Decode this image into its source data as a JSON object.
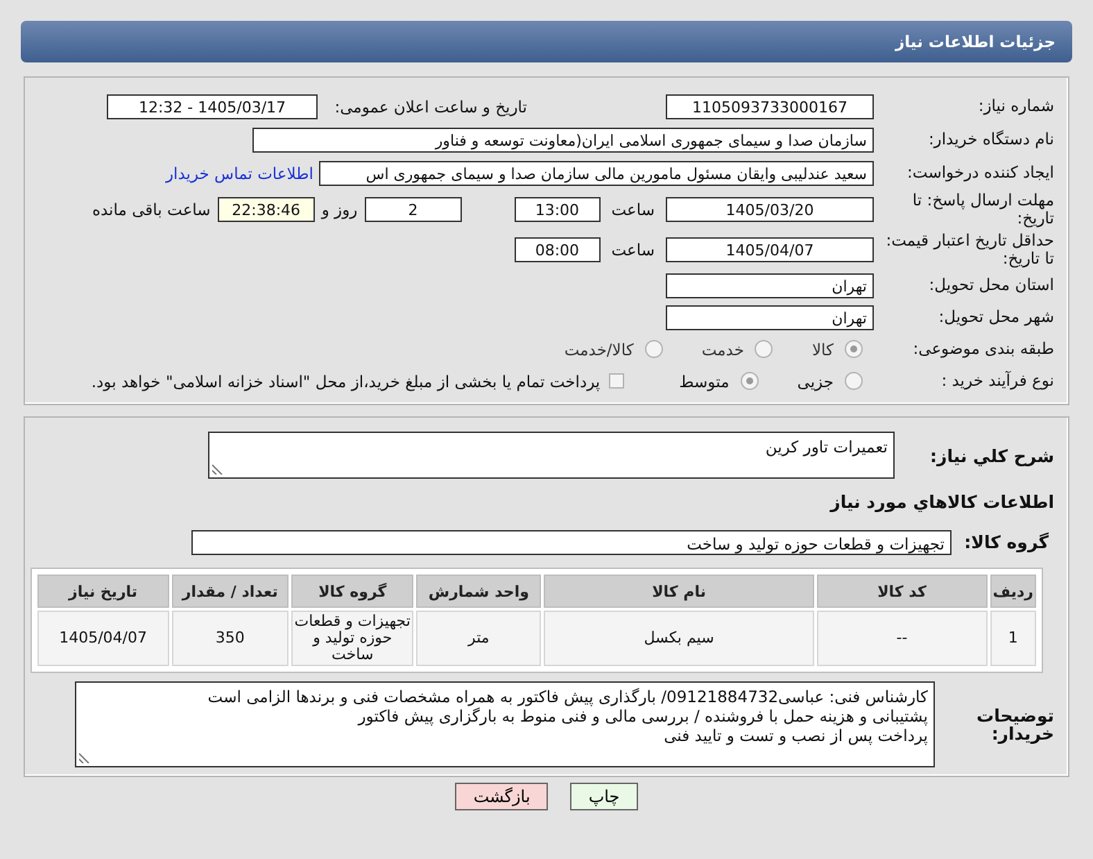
{
  "header": {
    "title": "جزئیات اطلاعات نیاز"
  },
  "need_number": {
    "label": "شماره نیاز:",
    "value": "1105093733000167"
  },
  "announce": {
    "label": "تاریخ و ساعت اعلان عمومی:",
    "value": "1405/03/17 - 12:32"
  },
  "buyer_org": {
    "label": "نام دستگاه خریدار:",
    "value": "سازمان صدا و سیمای جمهوری اسلامی ایران(معاونت توسعه و فناور"
  },
  "requester": {
    "label": "ایجاد کننده درخواست:",
    "value": "سعید عندلیبی وایقان مسئول مامورین مالی  سازمان صدا و سیمای جمهوری اس",
    "link": "اطلاعات تماس خریدار"
  },
  "reply_deadline": {
    "label": "مهلت ارسال پاسخ: تا تاریخ:",
    "date": "1405/03/20",
    "time_label": "ساعت",
    "time": "13:00",
    "days": "2",
    "days_label": "روز و",
    "remaining": "22:38:46",
    "remaining_label": "ساعت باقی مانده"
  },
  "price_validity": {
    "label": "حداقل تاریخ اعتبار قیمت: تا تاریخ:",
    "date": "1405/04/07",
    "time_label": "ساعت",
    "time": "08:00"
  },
  "province": {
    "label": "استان محل تحویل:",
    "value": "تهران"
  },
  "city": {
    "label": "شهر محل تحویل:",
    "value": "تهران"
  },
  "classification": {
    "label": "طبقه بندی موضوعی:",
    "options": [
      {
        "label": "کالا",
        "selected": true
      },
      {
        "label": "خدمت",
        "selected": false
      },
      {
        "label": "کالا/خدمت",
        "selected": false
      }
    ]
  },
  "process": {
    "label": "نوع فرآیند خرید :",
    "options": [
      {
        "label": "جزیی",
        "selected": false
      },
      {
        "label": "متوسط",
        "selected": true
      }
    ],
    "treasury": {
      "label": "پرداخت تمام یا بخشی از مبلغ خرید،از محل \"اسناد خزانه اسلامی\" خواهد بود.",
      "checked": false
    }
  },
  "description": {
    "label": "شرح کلي نیاز:",
    "value": "تعمیرات تاور کرین"
  },
  "goods_heading": "اطلاعات کالاهاي مورد نیاز",
  "goods_group": {
    "label": "گروه کالا:",
    "value": "تجهیزات و قطعات حوزه تولید و ساخت"
  },
  "table": {
    "columns": [
      "ردیف",
      "کد کالا",
      "نام کالا",
      "واحد شمارش",
      "گروه کالا",
      "تعداد / مقدار",
      "تاریخ نیاز"
    ],
    "rows": [
      [
        "1",
        "--",
        "سیم بکسل",
        "متر",
        "تجهیزات و قطعات حوزه تولید و ساخت",
        "350",
        "1405/04/07"
      ]
    ]
  },
  "buyer_notes": {
    "label": "توضیحات خریدار:",
    "lines": [
      "کارشناس فنی: عباسی09121884732/ بارگذاری پیش فاکتور به همراه مشخصات فنی و برندها الزامی است",
      "پشتیبانی و هزینه حمل با فروشنده / بررسی مالی و فنی منوط به بارگزاری پیش فاکتور",
      "پرداخت پس از نصب و تست و تایید فنی"
    ]
  },
  "buttons": [
    {
      "label": "چاپ",
      "kind": "print"
    },
    {
      "label": "بازگشت",
      "kind": "back"
    }
  ]
}
